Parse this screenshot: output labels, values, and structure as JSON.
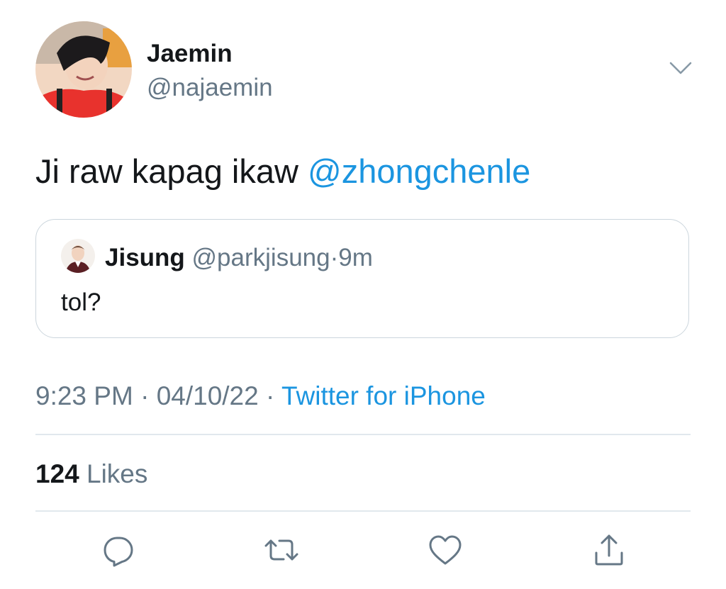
{
  "tweet": {
    "author": {
      "name": "Jaemin",
      "handle": "@najaemin",
      "avatar_icon": "profile-photo"
    },
    "text": "Ji raw kapag ikaw ",
    "mention": "@zhongchenle",
    "quoted": {
      "name": "Jisung",
      "handle": "@parkjisung",
      "separator": "·",
      "age": "9m",
      "text": "tol?",
      "avatar_icon": "profile-photo"
    },
    "meta": {
      "time": "9:23 PM",
      "dot1": " · ",
      "date": "04/10/22",
      "dot2": " · ",
      "source": "Twitter for iPhone"
    },
    "likes": {
      "count": "124",
      "label": " Likes"
    },
    "actions": [
      {
        "icon": "reply-icon"
      },
      {
        "icon": "retweet-icon"
      },
      {
        "icon": "like-icon"
      },
      {
        "icon": "share-icon"
      }
    ]
  },
  "colors": {
    "link": "#1b95e0",
    "secondary_text": "#657786",
    "primary_text": "#14171a",
    "divider": "#e1e8ed"
  }
}
